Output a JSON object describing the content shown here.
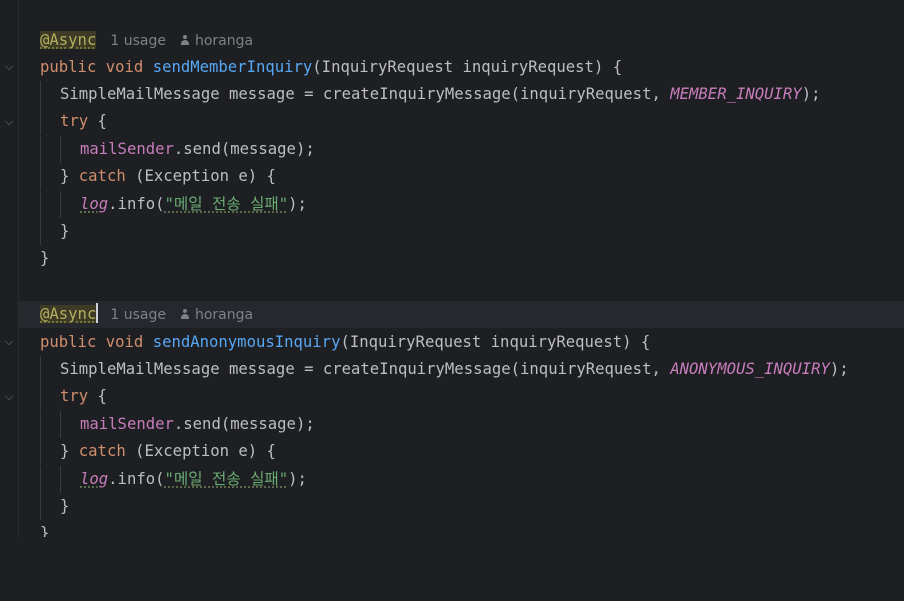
{
  "editor": {
    "annotation": "@Async",
    "usages": "1 usage",
    "author": "horanga",
    "kw_public": "public",
    "kw_void": "void",
    "kw_try": "try",
    "kw_catch": "catch",
    "method1_name": "sendMemberInquiry",
    "method2_name": "sendAnonymousInquiry",
    "params": "(InquiryRequest inquiryRequest) {",
    "msg_decl": "SimpleMailMessage message = createInquiryMessage(inquiryRequest, ",
    "const1": "MEMBER_INQUIRY",
    "const2": "ANONYMOUS_INQUIRY",
    "stmt_end": ");",
    "open_brace": " {",
    "mail_sender": "mailSender",
    "send_call": ".send(message);",
    "close_brace_catch_open": "} ",
    "catch_params": " (Exception e) {",
    "log_var": "log",
    "info_call": ".info(",
    "log_string": "\"메일 전송 실패\"",
    "close_brace": "}"
  }
}
